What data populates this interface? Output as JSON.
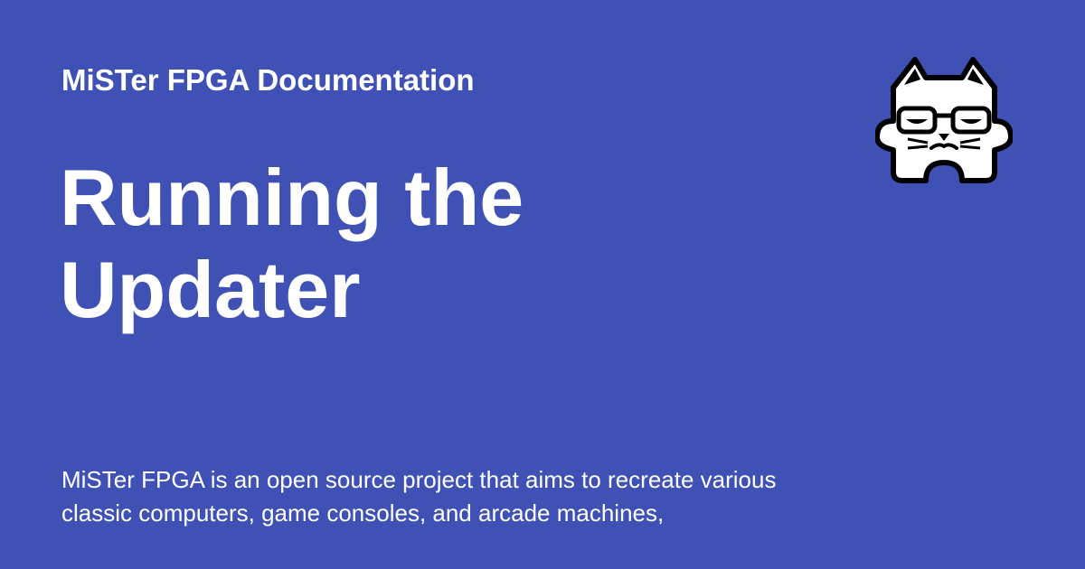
{
  "header": {
    "site_name": "MiSTer FPGA Documentation"
  },
  "main": {
    "title": "Running the Updater",
    "description": "MiSTer FPGA is an open source project that aims to recreate various classic computers, game consoles, and arcade machines,"
  },
  "logo": {
    "icon": "cat-mascot-icon"
  },
  "colors": {
    "background": "#3f51b5",
    "text": "#ffffff",
    "logo_fill": "#ffffff",
    "logo_stroke": "#000000"
  }
}
